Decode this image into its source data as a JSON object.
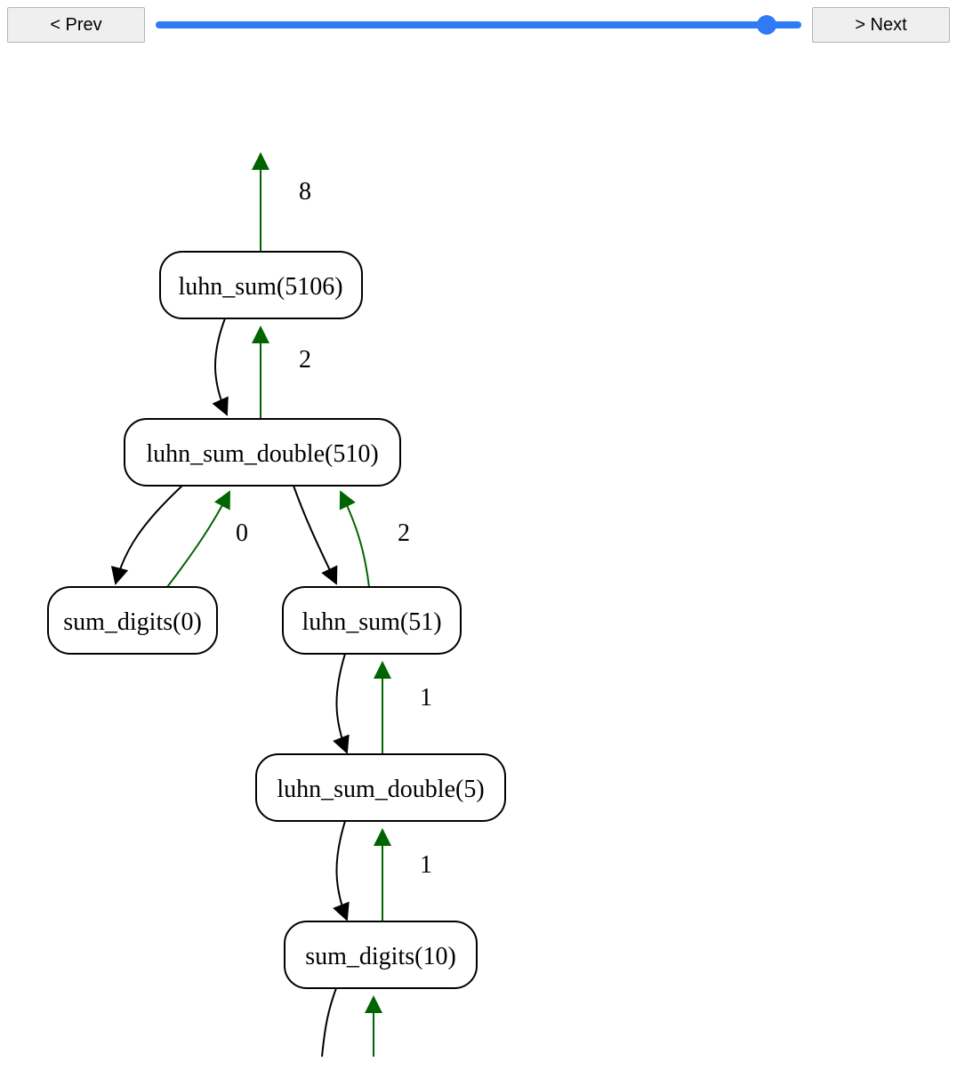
{
  "toolbar": {
    "prev_label": "< Prev",
    "next_label": "> Next",
    "slider_min": 0,
    "slider_max": 100,
    "slider_value": 96
  },
  "colors": {
    "call_edge": "#000000",
    "return_edge": "#006400",
    "node_stroke": "#000000",
    "node_fill": "#ffffff"
  },
  "nodes": {
    "n1": {
      "label": "luhn_sum(5106)"
    },
    "n2": {
      "label": "luhn_sum_double(510)"
    },
    "n3": {
      "label": "sum_digits(0)"
    },
    "n4": {
      "label": "luhn_sum(51)"
    },
    "n5": {
      "label": "luhn_sum_double(5)"
    },
    "n6": {
      "label": "sum_digits(10)"
    }
  },
  "edge_labels": {
    "ret_n1_top": "8",
    "ret_n2_n1": "2",
    "ret_n3_n2": "0",
    "ret_n4_n2": "2",
    "ret_n5_n4": "1",
    "ret_n6_n5": "1"
  }
}
